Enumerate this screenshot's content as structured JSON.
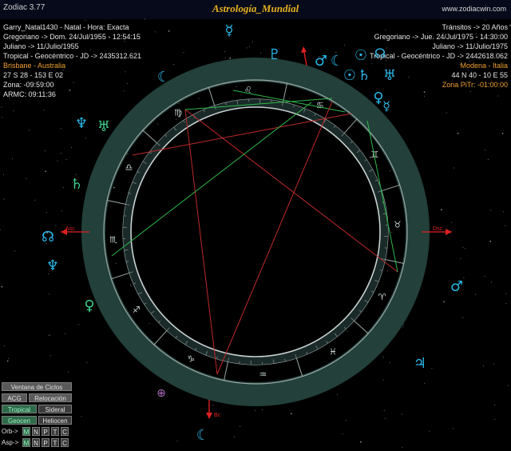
{
  "window": {
    "app_title": "Zodiac 3.77",
    "chart_title": "Astrología_Mundial",
    "website": "www.zodiacwin.com"
  },
  "natal": {
    "name_line": "Garry_Natal1430 - Natal - Hora: Exacta",
    "gregorian": "Gregoriano -> Dom. 24/Jul/1955 - 12:54:15",
    "julian": "Juliano -> 11/Julio/1955",
    "tropical": "Tropical - Geocéntrico - JD -> 2435312.621",
    "place": "Brisbane - Australia",
    "coords": "27 S 28 - 153 E 02",
    "zone": "Zona: -09:59:00",
    "armc": "ARMC: 09:11:36"
  },
  "transits": {
    "title": "Tránsitos -> 20 Años",
    "gregorian": "Gregoriano -> Jue. 24/Jul/1975 - 14:30:00",
    "julian": "Juliano -> 11/Julio/1975",
    "tropical": "Tropical - Geocéntrico - JD -> 2442618.062",
    "place": "Modena - Italia",
    "coords": "44 N 40 - 10 E 55",
    "zone": "Zona PiTr: -01:00:00"
  },
  "axes": {
    "asc": "Asc",
    "dsc": "Dsc",
    "mc": "Mc",
    "ic": "Bc"
  },
  "zodiac_signs": [
    "♈",
    "♉",
    "♊",
    "♋",
    "♌",
    "♍",
    "♎",
    "♏",
    "♐",
    "♑",
    "♒",
    "♓"
  ],
  "planets": {
    "sun": "☉",
    "moon": "☾",
    "mercury": "☿",
    "venus": "♀",
    "mars": "♂",
    "jupiter": "♃",
    "saturn": "♄",
    "uranus": "♅",
    "neptune": "♆",
    "pluto": "♇",
    "node": "☊",
    "fortune": "⊕"
  },
  "colors": {
    "ring_fill": "#23403a",
    "ring_stroke": "#8a9a98",
    "inner_stroke": "#c8d0d0",
    "planet_cyan": "#2ab8e8",
    "planet_green": "#3fcf8f",
    "aspect_red": "#c02a2a",
    "aspect_green": "#2fb84a",
    "axis_red": "#e02020",
    "info_orange": "#f0a030"
  },
  "control_panel": {
    "cycles_window": "Ventana de Ciclos",
    "acg": "ACG",
    "relocation": "Relocación",
    "tropical": "Tropical",
    "sidereal": "Sideral",
    "geocentric": "Geocen",
    "heliocentric": "Heliocen",
    "orb_label": "Orb->",
    "asp_label": "Asp->",
    "toggles": [
      "M",
      "N",
      "P",
      "T",
      "C"
    ]
  }
}
